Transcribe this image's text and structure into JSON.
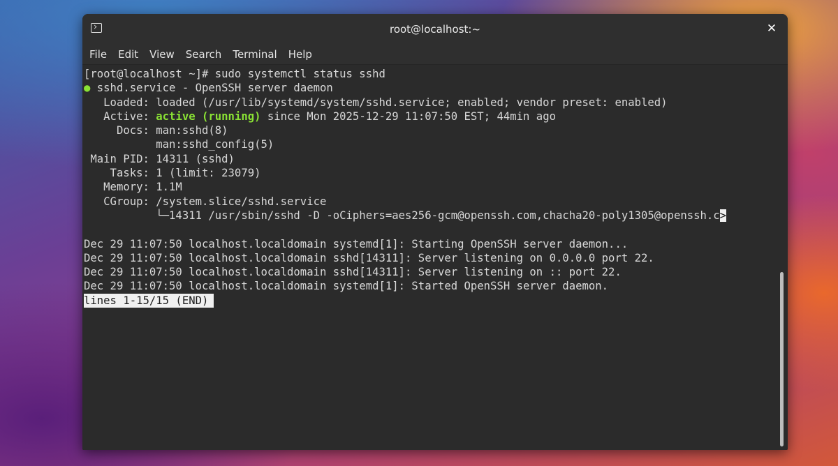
{
  "window": {
    "title": "root@localhost:~",
    "close_symbol": "✕"
  },
  "menu": [
    "File",
    "Edit",
    "View",
    "Search",
    "Terminal",
    "Help"
  ],
  "terminal": {
    "lines": [
      {
        "text": "[root@localhost ~]# sudo systemctl status sshd"
      },
      {
        "prefix": "● ",
        "text": "sshd.service - OpenSSH server daemon"
      },
      {
        "text": "   Loaded: loaded (/usr/lib/systemd/system/sshd.service; enabled; vendor preset: enabled)"
      },
      {
        "pre": "   Active: ",
        "highlight": "active (running)",
        "post": " since Mon 2025-12-29 11:07:50 EST; 44min ago"
      },
      {
        "text": "     Docs: man:sshd(8)"
      },
      {
        "text": "           man:sshd_config(5)"
      },
      {
        "text": " Main PID: 14311 (sshd)"
      },
      {
        "text": "    Tasks: 1 (limit: 23079)"
      },
      {
        "text": "   Memory: 1.1M"
      },
      {
        "text": "   CGroup: /system.slice/sshd.service"
      },
      {
        "text": "           └─14311 /usr/sbin/sshd -D -oCiphers=aes256-gcm@openssh.com,chacha20-poly1305@openssh.c",
        "trunc": ">"
      },
      {
        "text": ""
      },
      {
        "text": "Dec 29 11:07:50 localhost.localdomain systemd[1]: Starting OpenSSH server daemon..."
      },
      {
        "text": "Dec 29 11:07:50 localhost.localdomain sshd[14311]: Server listening on 0.0.0.0 port 22."
      },
      {
        "text": "Dec 29 11:07:50 localhost.localdomain sshd[14311]: Server listening on :: port 22."
      },
      {
        "text": "Dec 29 11:07:50 localhost.localdomain systemd[1]: Started OpenSSH server daemon."
      }
    ],
    "pager_status": "lines 1-15/15 (END)"
  },
  "colors": {
    "terminal_bg": "#2b2b2b",
    "status_green": "#8ae234",
    "text": "#d8d8d8"
  },
  "icons": {
    "titlebar": "terminal-icon",
    "close": "close-icon"
  }
}
